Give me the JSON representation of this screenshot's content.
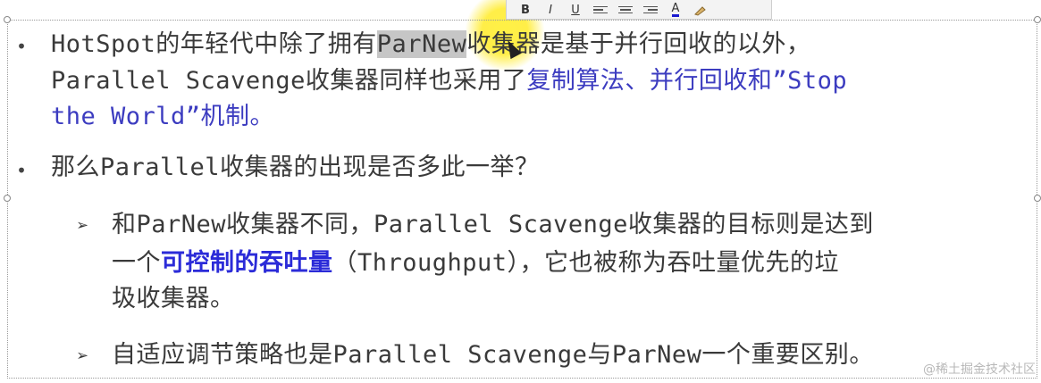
{
  "toolbar": {
    "bold": "B",
    "italic": "I",
    "underline": "U",
    "font_color": "A"
  },
  "bullets": [
    {
      "line1": {
        "before": "HotSpot的年轻代中除了拥有",
        "selected": "ParNew",
        "after": "收集器是基于并行回收的以外，"
      },
      "line2": {
        "plain": "Parallel Scavenge收集器同样也采用了",
        "blue": "复制算法、并行回收和”Stop"
      },
      "line3": {
        "blue": "the World”机制。"
      }
    },
    {
      "text": "那么Parallel收集器的出现是否多此一举？"
    }
  ],
  "sub_bullets": [
    {
      "line1": "和ParNew收集器不同，Parallel Scavenge收集器的目标则是达到",
      "line2_before": "一个",
      "line2_bold": "可控制的吞吐量",
      "line2_after": "（Throughput），它也被称为吞吐量优先的垃",
      "line3": "圾收集器。"
    },
    {
      "text": "自适应调节策略也是Parallel Scavenge与ParNew一个重要区别。"
    }
  ],
  "markers": {
    "dot": "•",
    "arrow": "➢"
  },
  "watermark": "@稀土掘金技术社区",
  "colors": {
    "blue_text": "#3c3cc0",
    "bold_blue": "#2b2bd8",
    "highlight": "#ffeb28"
  }
}
